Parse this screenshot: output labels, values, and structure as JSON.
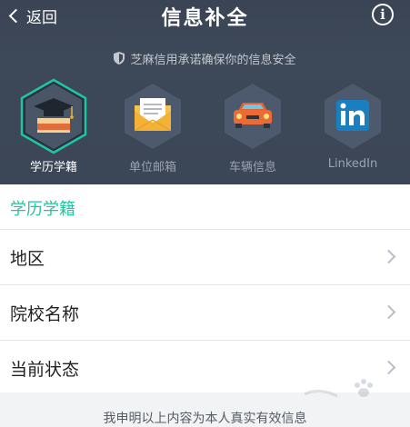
{
  "navbar": {
    "back_label": "返回",
    "title": "信息补全",
    "info_glyph": "i"
  },
  "security_note": "芝麻信用承诺确保你的信息安全",
  "categories": [
    {
      "label": "学历学籍",
      "icon": "graduation-cap-icon",
      "active": true
    },
    {
      "label": "单位邮箱",
      "icon": "envelope-icon",
      "active": false
    },
    {
      "label": "车辆信息",
      "icon": "car-icon",
      "active": false
    },
    {
      "label": "LinkedIn",
      "icon": "linkedin-icon",
      "active": false
    }
  ],
  "section_title": "学历学籍",
  "rows": [
    {
      "label": "地区"
    },
    {
      "label": "院校名称"
    },
    {
      "label": "当前状态"
    }
  ],
  "declaration": "我申明以上内容为本人真实有效信息",
  "colors": {
    "header_bg": "#3b4656",
    "accent": "#1fc6a0",
    "hex_inactive": "#4d5a6d"
  }
}
